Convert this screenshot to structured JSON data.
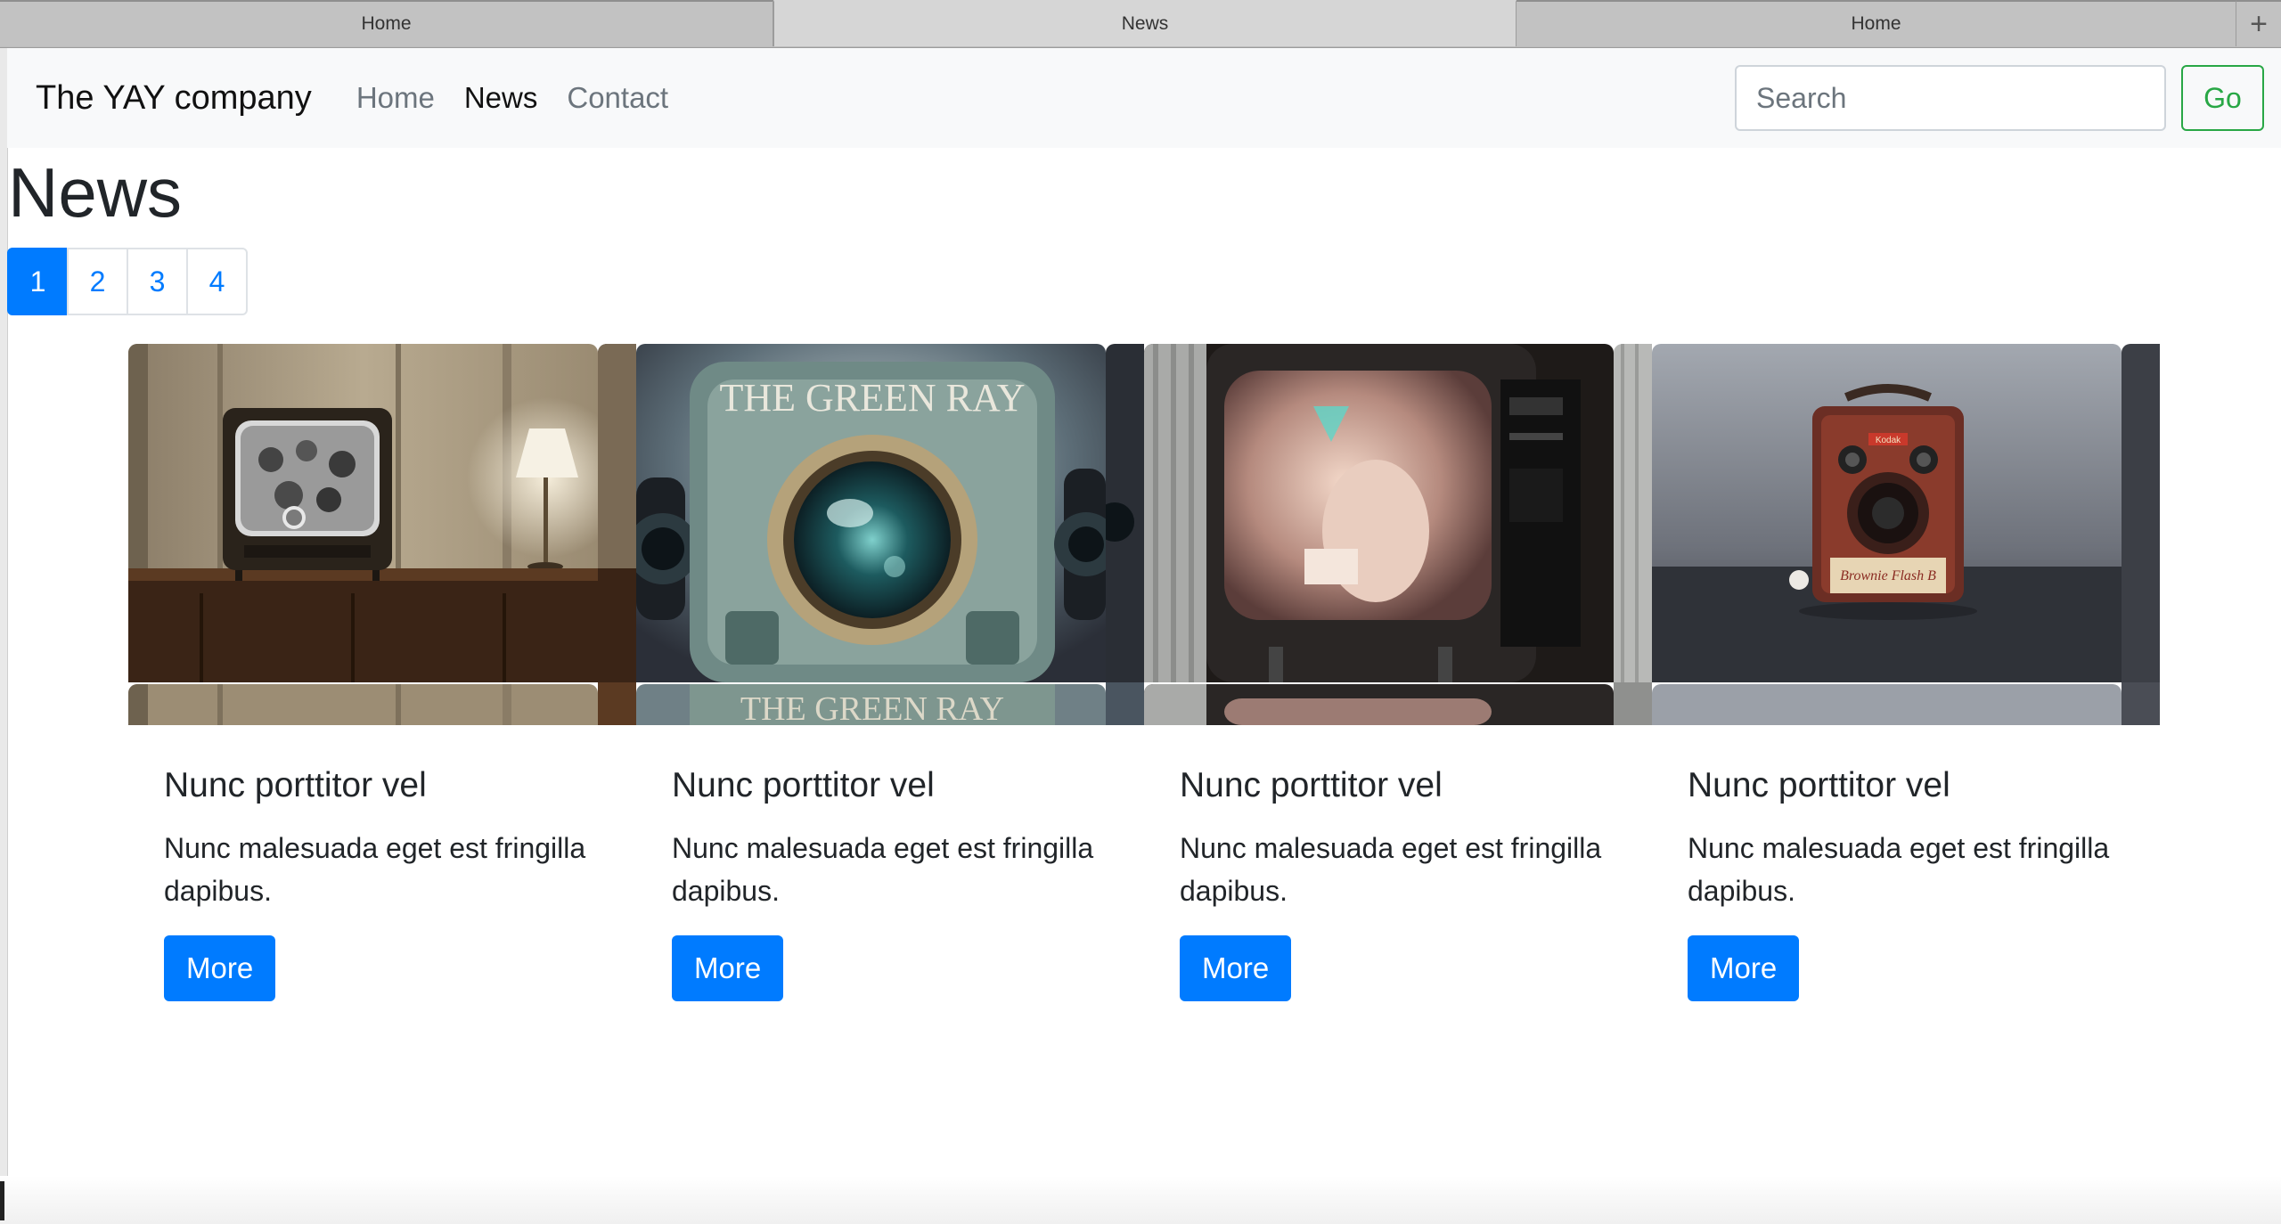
{
  "browser": {
    "tabs": [
      {
        "label": "Home",
        "active": false
      },
      {
        "label": "News",
        "active": true
      },
      {
        "label": "Home",
        "active": false
      }
    ],
    "new_tab_icon": "plus-icon"
  },
  "navbar": {
    "brand": "The YAY company",
    "links": [
      {
        "label": "Home",
        "active": false
      },
      {
        "label": "News",
        "active": true
      },
      {
        "label": "Contact",
        "active": false
      }
    ],
    "search": {
      "placeholder": "Search",
      "value": ""
    },
    "go_label": "Go"
  },
  "page": {
    "title": "News",
    "pagination": {
      "pages": [
        "1",
        "2",
        "3",
        "4"
      ],
      "current": "1"
    }
  },
  "cards": [
    {
      "image": "vintage-tv-photo",
      "title": "Nunc porttitor vel",
      "text": "Nunc malesuada eget est fringilla dapibus.",
      "button": "More"
    },
    {
      "image": "green-ray-camera-photo",
      "title": "Nunc porttitor vel",
      "text": "Nunc malesuada eget est fringilla dapibus.",
      "button": "More"
    },
    {
      "image": "retro-tv-screen-photo",
      "title": "Nunc porttitor vel",
      "text": "Nunc malesuada eget est fringilla dapibus.",
      "button": "More"
    },
    {
      "image": "brownie-camera-photo",
      "title": "Nunc porttitor vel",
      "text": "Nunc malesuada eget est fringilla dapibus.",
      "button": "More"
    }
  ],
  "image_texts": {
    "green_ray": "THE GREEN RAY",
    "green_ray_strip": "THE GREEN RAY",
    "kodak_badge": "Kodak",
    "brownie_label": "Brownie Flash B"
  },
  "colors": {
    "primary": "#007bff",
    "success": "#28a745",
    "navbar_bg": "#f8f9fa",
    "muted": "#6c757d"
  }
}
